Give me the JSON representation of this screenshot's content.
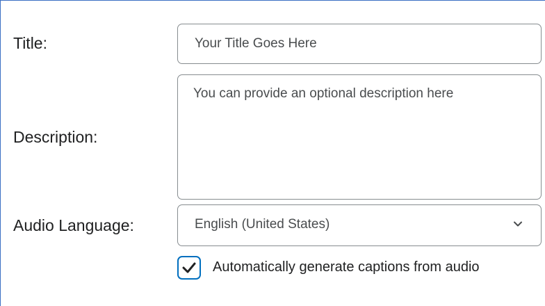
{
  "form": {
    "title_label": "Title:",
    "title_value": "Your Title Goes Here",
    "description_label": "Description:",
    "description_value": "You can provide an optional description here",
    "audio_language_label": "Audio Language:",
    "audio_language_selected": "English (United States)",
    "captions_checkbox_label": "Automatically generate captions from audio",
    "captions_checkbox_checked": true
  },
  "icons": {
    "dropdown": "chevron-down-icon",
    "checkmark": "checkmark-icon"
  },
  "colors": {
    "frame_border": "#3a6fc4",
    "field_border": "#868c8f",
    "checkbox_accent": "#006fbf",
    "label_text": "#202122",
    "field_text": "#494c4e"
  }
}
